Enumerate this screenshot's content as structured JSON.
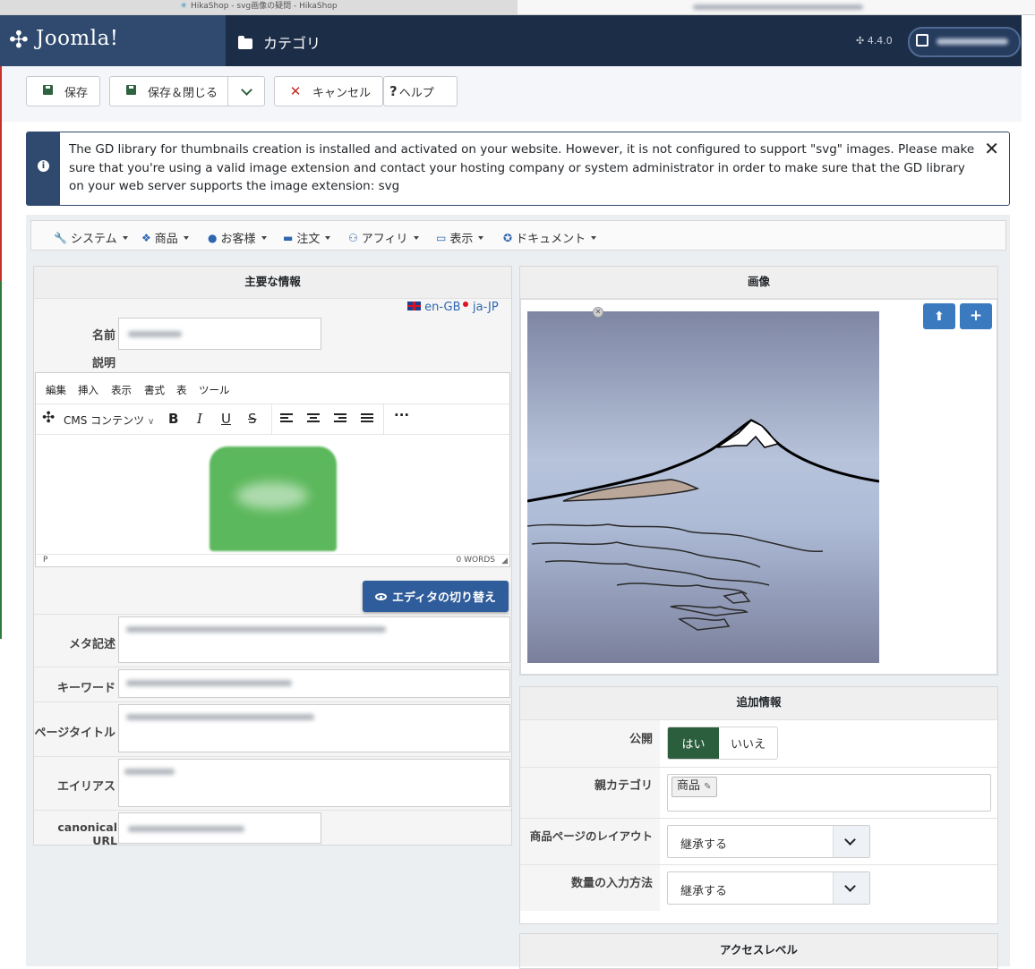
{
  "browser": {
    "tab_title": "HikaShop - svg画像の疑問 - HikaShop"
  },
  "header": {
    "brand": "Joomla!",
    "title": "カテゴリ",
    "version": "4.4.0"
  },
  "toolbar": {
    "save": "保存",
    "save_close": "保存＆閉じる",
    "cancel": "キャンセル",
    "help": "ヘルプ"
  },
  "alert": {
    "message": "The GD library for thumbnails creation is installed and activated on your website. However, it is not configured to support \"svg\" images. Please make sure that you're using a valid image extension and contact your hosting company or system administrator in order to make sure that the GD library on your web server supports the image extension: svg",
    "close": "✕"
  },
  "hika_menu": [
    "システム",
    "商品",
    "お客様",
    "注文",
    "アフィリ",
    "表示",
    "ドキュメント"
  ],
  "main_info": {
    "heading": "主要な情報",
    "lang_en": "en-GB",
    "lang_ja": "ja-JP",
    "name_label": "名前",
    "desc_label": "説明",
    "editor_menu": [
      "編集",
      "挿入",
      "表示",
      "書式",
      "表",
      "ツール"
    ],
    "cms_content": "CMS コンテンツ",
    "status_p": "P",
    "word_count": "0 WORDS",
    "switch_editor": "エディタの切り替え",
    "meta_label": "メタ記述",
    "keyword_label": "キーワード",
    "page_title_label": "ページタイトル",
    "alias_label": "エイリアス",
    "canonical_label": "canonical URL"
  },
  "image_panel": {
    "heading": "画像"
  },
  "extra_info": {
    "heading": "追加情報",
    "publish_label": "公開",
    "yes": "はい",
    "no": "いいえ",
    "parent_label": "親カテゴリ",
    "parent_tag": "商品",
    "layout_label": "商品ページのレイアウト",
    "layout_value": "継承する",
    "qty_label": "数量の入力方法",
    "qty_value": "継承する"
  },
  "access": {
    "heading": "アクセスレベル"
  },
  "colors": {
    "header": "#1c2d47",
    "brand": "#2f4a6e",
    "publish_on": "#2b5e3d",
    "primary_btn": "#2f5c9a"
  }
}
